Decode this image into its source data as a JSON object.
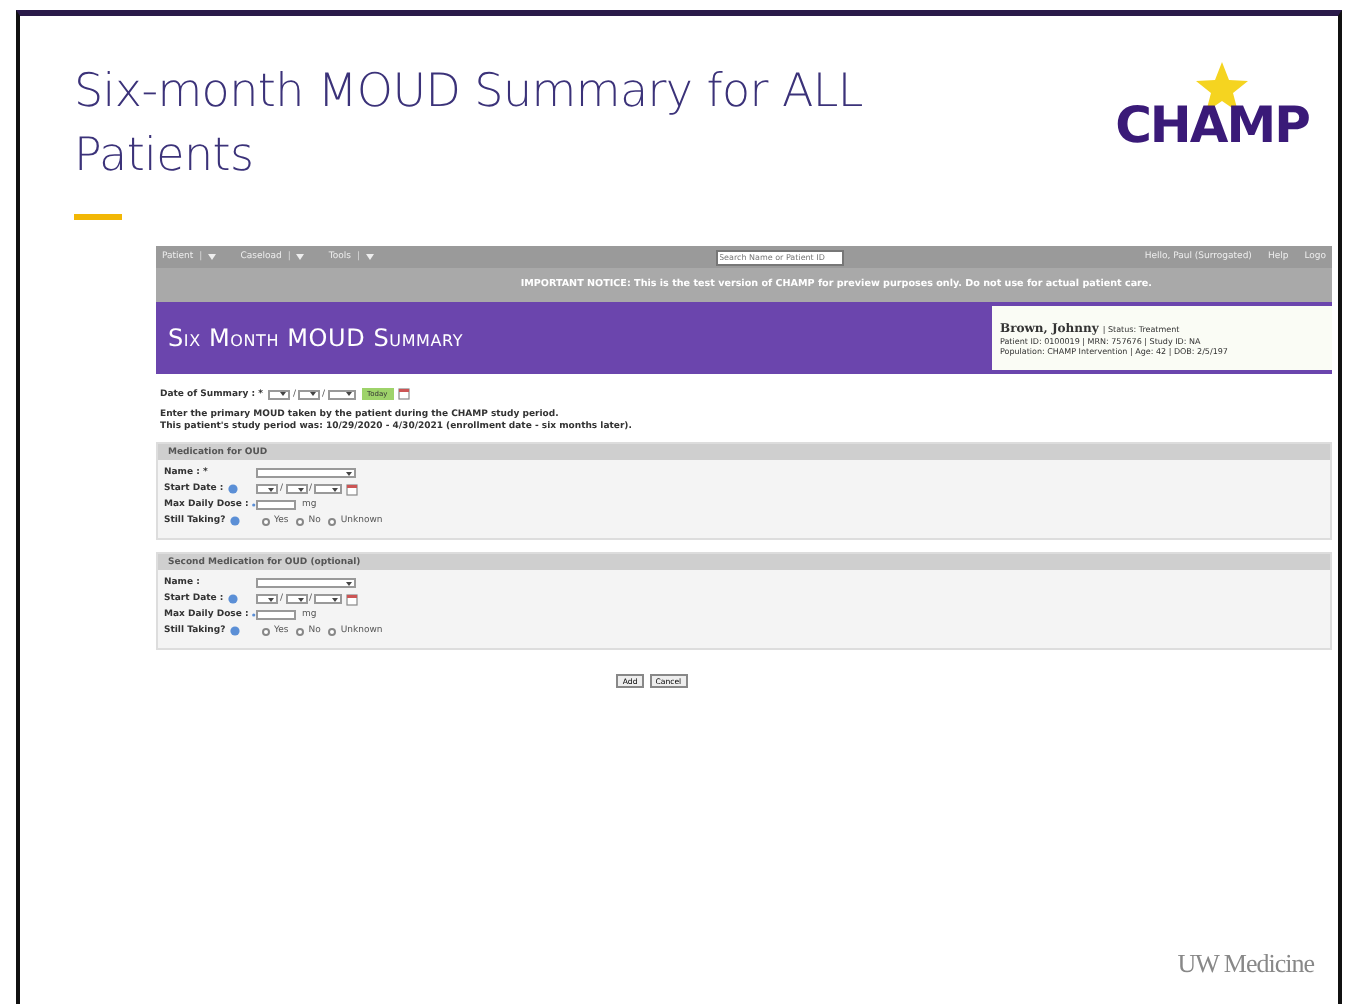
{
  "slide": {
    "title": "Six-month MOUD Summary for ALL Patients",
    "logo": "CHAMP",
    "footer": "UW Medicine"
  },
  "app": {
    "nav": {
      "menus": [
        {
          "label": "Patient",
          "separator": "|"
        },
        {
          "label": "Caseload",
          "separator": "|"
        },
        {
          "label": "Tools",
          "separator": "|"
        }
      ],
      "search": {
        "placeholder": "Search Name or Patient ID"
      },
      "user": "Hello, Paul (Surrogated)",
      "links": [
        "Help",
        "Logo"
      ]
    },
    "notice": "IMPORTANT NOTICE: This is the test version of CHAMP for preview purposes only. Do not use for actual patient care.",
    "banner": "Six Month MOUD Summary",
    "patient": {
      "name": "Brown, Johnny",
      "status": "| Status: Treatment",
      "line_2": "Patient ID: 0100019 | MRN: 757676 | Study ID: NA",
      "line_3": "Population: CHAMP Intervention | Age: 42 | DOB: 2/5/197"
    },
    "date_separator": "/",
    "date_of_summary": {
      "label": "Date of Summary : *",
      "today_button": "Today"
    },
    "instructions": [
      "Enter the primary MOUD taken by the patient during the CHAMP study period.",
      "This patient's study period was: 10/29/2020 - 4/30/2021 (enrollment date - six months later)."
    ],
    "sections": [
      {
        "title": "Medication for OUD",
        "fields": [
          {
            "kind": "select",
            "label": "Name : *"
          },
          {
            "kind": "date",
            "label": "Start Date :"
          },
          {
            "kind": "dose",
            "label": "Max Daily Dose :",
            "unit": "mg"
          },
          {
            "kind": "radio",
            "label": "Still Taking?",
            "options": [
              {
                "label": "Yes",
                "selected": false
              },
              {
                "label": "No",
                "selected": false
              },
              {
                "label": "Unknown",
                "selected": false
              }
            ]
          }
        ]
      },
      {
        "title": "Second Medication for OUD (optional)",
        "fields": [
          {
            "kind": "select",
            "label": "Name :"
          },
          {
            "kind": "date",
            "label": "Start Date :"
          },
          {
            "kind": "dose",
            "label": "Max Daily Dose :",
            "unit": "mg"
          },
          {
            "kind": "radio",
            "label": "Still Taking?",
            "options": [
              {
                "label": "Yes",
                "selected": false
              },
              {
                "label": "No",
                "selected": false
              },
              {
                "label": "Unknown",
                "selected": false
              }
            ]
          }
        ]
      }
    ],
    "buttons": [
      "Add",
      "Cancel"
    ]
  }
}
